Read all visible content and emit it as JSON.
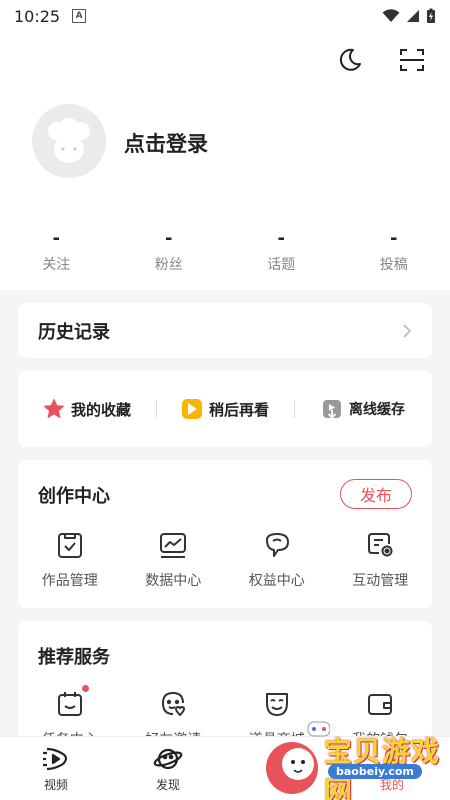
{
  "status": {
    "time": "10:25",
    "a_badge": "A"
  },
  "header": {
    "login_label": "点击登录"
  },
  "stats": [
    {
      "value": "-",
      "label": "关注"
    },
    {
      "value": "-",
      "label": "粉丝"
    },
    {
      "value": "-",
      "label": "话题"
    },
    {
      "value": "-",
      "label": "投稿"
    }
  ],
  "history": {
    "label": "历史记录"
  },
  "quick": [
    {
      "label": "我的收藏",
      "icon": "star-icon"
    },
    {
      "label": "稍后再看",
      "icon": "watch-later-icon"
    },
    {
      "label": "离线缓存",
      "icon": "download-icon"
    }
  ],
  "create_center": {
    "title": "创作中心",
    "publish_label": "发布",
    "items": [
      {
        "label": "作品管理",
        "icon": "works-icon"
      },
      {
        "label": "数据中心",
        "icon": "data-chart-icon"
      },
      {
        "label": "权益中心",
        "icon": "rights-icon"
      },
      {
        "label": "互动管理",
        "icon": "interaction-icon"
      }
    ]
  },
  "services": {
    "title": "推荐服务",
    "items": [
      {
        "label": "任务中心",
        "icon": "task-calendar-icon"
      },
      {
        "label": "好友邀请",
        "icon": "invite-friend-icon"
      },
      {
        "label": "道具商城",
        "icon": "mask-icon"
      },
      {
        "label": "我的钱包",
        "icon": "wallet-icon"
      }
    ]
  },
  "tabbar": [
    {
      "label": "视频",
      "icon": "video-tab-icon"
    },
    {
      "label": "发现",
      "icon": "discover-planet-icon"
    },
    {
      "label": "",
      "icon": ""
    },
    {
      "label": "我的",
      "icon": "profile-tab-icon",
      "active": true
    }
  ],
  "watermark": {
    "text": "宝贝游戏网",
    "url": "baobeiy.com"
  },
  "colors": {
    "accent": "#e8535b",
    "background": "#f5f5f5",
    "card": "#ffffff"
  }
}
